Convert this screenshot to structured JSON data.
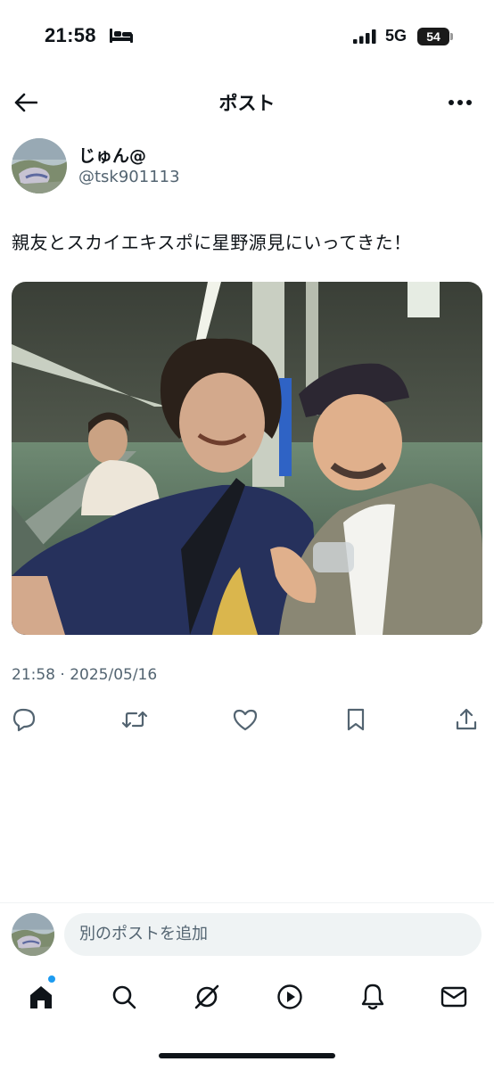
{
  "status_bar": {
    "time": "21:58",
    "network": "5G",
    "battery": "54"
  },
  "header": {
    "title": "ポスト"
  },
  "post": {
    "author_name": "じゅん@",
    "author_handle": "@tsk901113",
    "text": "親友とスカイエキスポに星野源見にいってきた！",
    "timestamp": "21:58 · 2025/05/16"
  },
  "icons": {
    "back": "arrow-left-icon",
    "more": "more-horizontal-icon",
    "reply": "reply-icon",
    "repost": "repost-icon",
    "like": "heart-icon",
    "bookmark": "bookmark-icon",
    "share": "share-icon",
    "tabs": [
      "home-icon",
      "search-icon",
      "grok-icon",
      "video-icon",
      "notifications-icon",
      "messages-icon"
    ]
  },
  "composer": {
    "placeholder": "別のポストを追加"
  },
  "colors": {
    "text": "#0f1419",
    "secondary": "#536471",
    "accent": "#1d9bf0",
    "input_bg": "#eff3f4"
  }
}
